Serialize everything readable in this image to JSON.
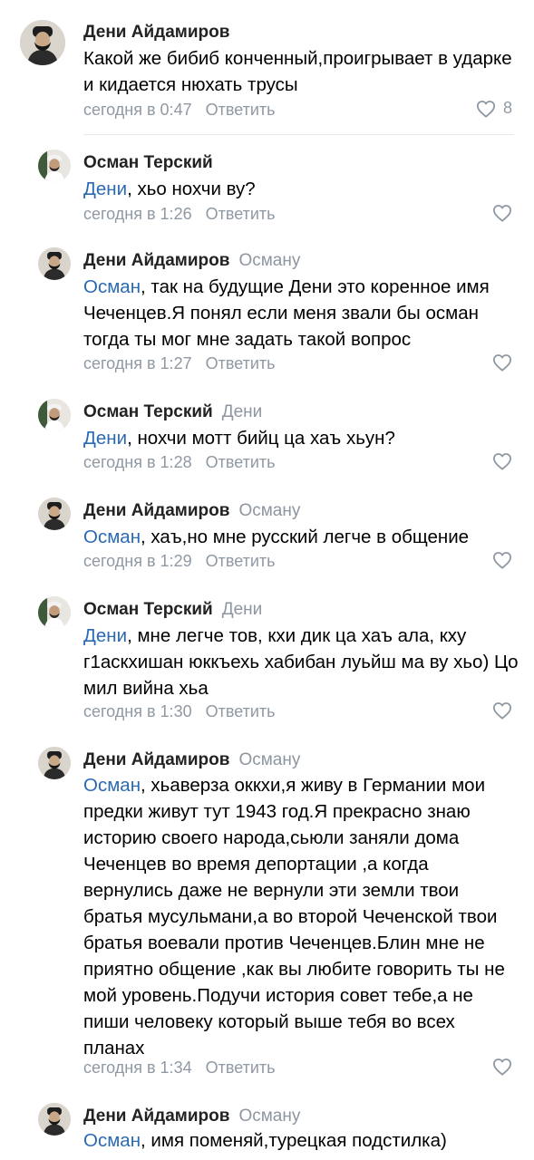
{
  "comments": [
    {
      "author": "Дени Айдамиров",
      "reply_to": "",
      "mention": "",
      "text": "Какой же бибиб конченный,проигрывает в ударке и кидается нюхать трусы",
      "time": "сегодня в 0:47",
      "reply_label": "Ответить",
      "likes": "8",
      "avatar": "deni"
    },
    {
      "author": "Осман Терский",
      "reply_to": "",
      "mention": "Дени",
      "text": ", хьо нохчи ву?",
      "time": "сегодня в 1:26",
      "reply_label": "Ответить",
      "likes": "",
      "avatar": "osman"
    },
    {
      "author": "Дени Айдамиров",
      "reply_to": "Осману",
      "mention": "Осман",
      "text": ", так на будущие Дени это коренное имя Чеченцев.Я понял если меня звали бы осман тогда ты мог мне задать такой вопрос",
      "time": "сегодня в 1:27",
      "reply_label": "Ответить",
      "likes": "",
      "avatar": "deni"
    },
    {
      "author": "Осман Терский",
      "reply_to": "Дени",
      "mention": "Дени",
      "text": ", нохчи мотт бийц ца хаъ хьун?",
      "time": "сегодня в 1:28",
      "reply_label": "Ответить",
      "likes": "",
      "avatar": "osman"
    },
    {
      "author": "Дени Айдамиров",
      "reply_to": "Осману",
      "mention": "Осман",
      "text": ", хаъ,но мне русский легче в общение",
      "time": "сегодня в 1:29",
      "reply_label": "Ответить",
      "likes": "",
      "avatar": "deni"
    },
    {
      "author": "Осман Терский",
      "reply_to": "Дени",
      "mention": "Дени",
      "text": ", мне легче тов, кхи дик ца хаъ ала, кху г1аскхишан юккъехь хабибан луьйш ма ву хьо) Цо мил вийна хьа",
      "time": "сегодня в 1:30",
      "reply_label": "Ответить",
      "likes": "",
      "avatar": "osman"
    },
    {
      "author": "Дени Айдамиров",
      "reply_to": "Осману",
      "mention": "Осман",
      "text": ", хьаверза оккхи,я живу в Германии мои предки живут тут 1943 год.Я прекрасно знаю историю своего народа,сьюли заняли дома Чеченцев во время депортации ,а когда вернулись даже не вернули эти земли твои братья мусульмани,а во второй Чеченской твои братья воевали против Чеченцев.Блин мне не приятно общение ,как вы любите говорить ты не мой уровень.Подучи история совет тебе,а не пиши человеку который выше тебя во всех планах",
      "time": "сегодня в 1:34",
      "reply_label": "Ответить",
      "likes": "",
      "avatar": "deni"
    },
    {
      "author": "Дени Айдамиров",
      "reply_to": "Осману",
      "mention": "Осман",
      "text": ", имя поменяй,турецкая подстилка)",
      "time": "",
      "reply_label": "",
      "likes": "",
      "avatar": "deni"
    }
  ]
}
